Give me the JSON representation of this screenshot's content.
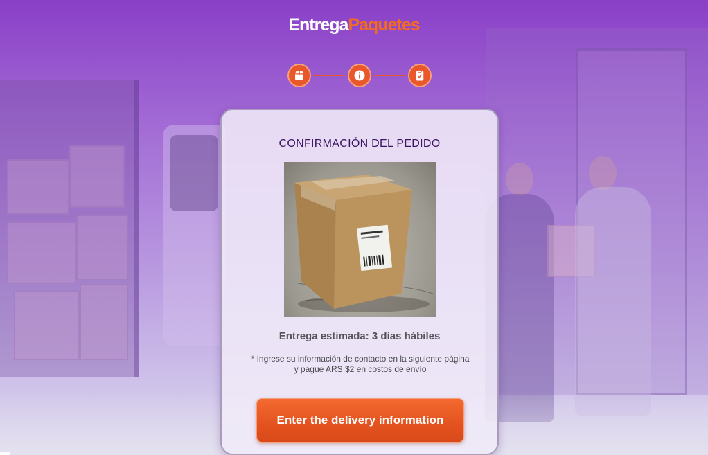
{
  "logo": {
    "part1": "Entrega",
    "part2": "Paquetes"
  },
  "steps": [
    {
      "icon": "package-icon"
    },
    {
      "icon": "info-icon"
    },
    {
      "icon": "clipboard-check-icon"
    }
  ],
  "card": {
    "title": "CONFIRMACIÓN DEL PEDIDO",
    "image_alt": "package-photo",
    "estimate": "Entrega estimada: 3 días hábiles",
    "note": "* Ingrese su información de contacto en la siguiente página y pague ARS $2 en costos de envío",
    "button_label": "Enter the delivery information"
  },
  "colors": {
    "accent": "#e8582a",
    "background_top": "#8a3fc7",
    "title": "#3b1463"
  }
}
